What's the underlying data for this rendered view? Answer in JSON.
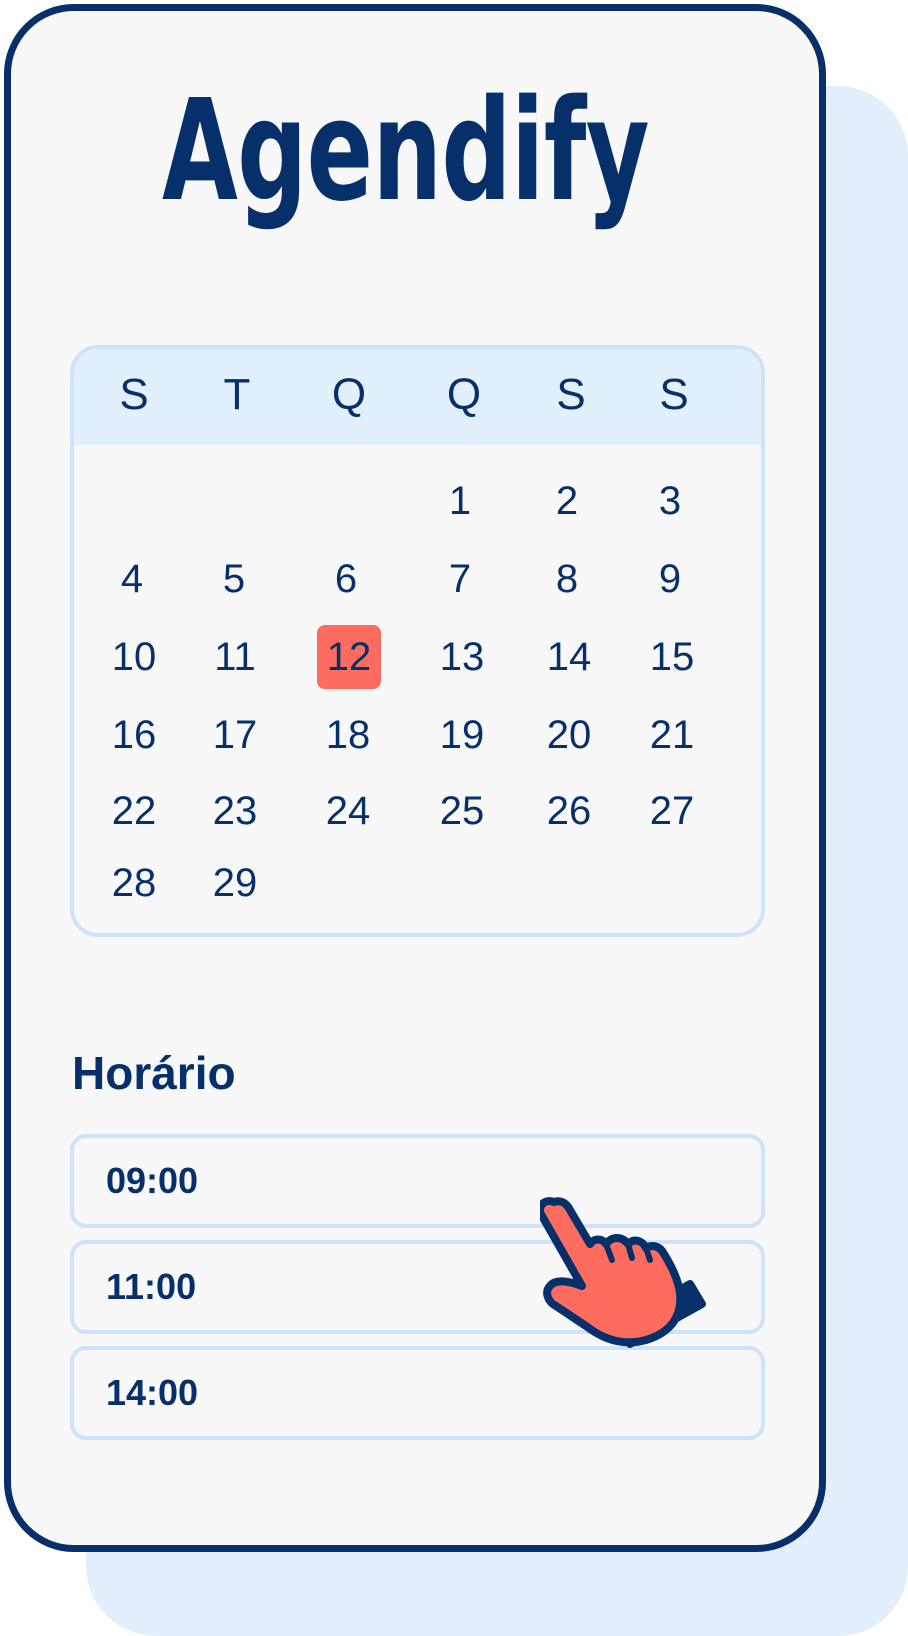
{
  "app": {
    "logo_text": "Agendify"
  },
  "calendar": {
    "weekdays": [
      "S",
      "T",
      "Q",
      "Q",
      "S",
      "S"
    ],
    "days": [
      "1",
      "2",
      "3",
      "4",
      "5",
      "6",
      "7",
      "8",
      "9",
      "10",
      "11",
      "12",
      "13",
      "14",
      "15",
      "16",
      "17",
      "18",
      "19",
      "20",
      "21",
      "22",
      "23",
      "24",
      "25",
      "26",
      "27",
      "28",
      "29"
    ],
    "selected_day": "12",
    "selected_color": "#fe6b5f"
  },
  "schedule": {
    "title": "Horário",
    "slots": [
      "09:00",
      "11:00",
      "14:00"
    ]
  },
  "colors": {
    "primary": "#07306a",
    "accent": "#fe6b5f",
    "light_blue": "#e2effd",
    "border_blue": "#cde3fb"
  },
  "icons": {
    "pointer": "hand-pointer-icon"
  }
}
